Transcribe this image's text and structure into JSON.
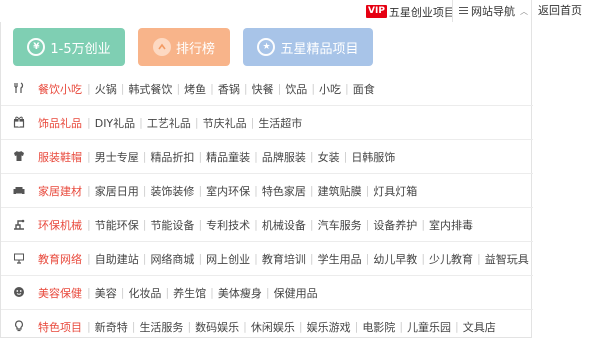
{
  "topbar": {
    "vip_badge": "VIP",
    "vip_label": "五星创业项目",
    "nav_label": "网站导航",
    "home_label": "返回首页"
  },
  "buttons": [
    {
      "label": "1-5万创业",
      "icon": "yen-icon",
      "icon_glyph": "¥",
      "color": "#7fcfb3"
    },
    {
      "label": "排行榜",
      "icon": "rank-icon",
      "icon_glyph": "",
      "color": "#f8b48a"
    },
    {
      "label": "五星精品项目",
      "icon": "star-icon",
      "icon_glyph": "★",
      "color": "#a8c4e8"
    }
  ],
  "categories": [
    {
      "name": "餐饮小吃",
      "icon": "fork-knife-icon",
      "links": [
        "火锅",
        "韩式餐饮",
        "烤鱼",
        "香锅",
        "快餐",
        "饮品",
        "小吃",
        "面食"
      ]
    },
    {
      "name": "饰品礼品",
      "icon": "gift-icon",
      "links": [
        "DIY礼品",
        "工艺礼品",
        "节庆礼品",
        "生活超市"
      ]
    },
    {
      "name": "服装鞋帽",
      "icon": "shirt-icon",
      "links": [
        "男士专屋",
        "精品折扣",
        "精品童装",
        "品牌服装",
        "女装",
        "日韩服饰"
      ]
    },
    {
      "name": "家居建材",
      "icon": "sofa-icon",
      "links": [
        "家居日用",
        "装饰装修",
        "室内环保",
        "特色家居",
        "建筑贴膜",
        "灯具灯箱"
      ]
    },
    {
      "name": "环保机械",
      "icon": "machine-icon",
      "links": [
        "节能环保",
        "节能设备",
        "专利技术",
        "机械设备",
        "汽车服务",
        "设备养护",
        "室内排毒"
      ]
    },
    {
      "name": "教育网络",
      "icon": "monitor-icon",
      "links": [
        "自助建站",
        "网络商城",
        "网上创业",
        "教育培训",
        "学生用品",
        "幼儿早教",
        "少儿教育",
        "益智玩具"
      ]
    },
    {
      "name": "美容保健",
      "icon": "face-icon",
      "links": [
        "美容",
        "化妆品",
        "养生馆",
        "美体瘦身",
        "保健用品"
      ]
    },
    {
      "name": "特色项目",
      "icon": "bulb-icon",
      "links": [
        "新奇特",
        "生活服务",
        "数码娱乐",
        "休闲娱乐",
        "娱乐游戏",
        "电影院",
        "儿童乐园",
        "文具店"
      ]
    }
  ]
}
